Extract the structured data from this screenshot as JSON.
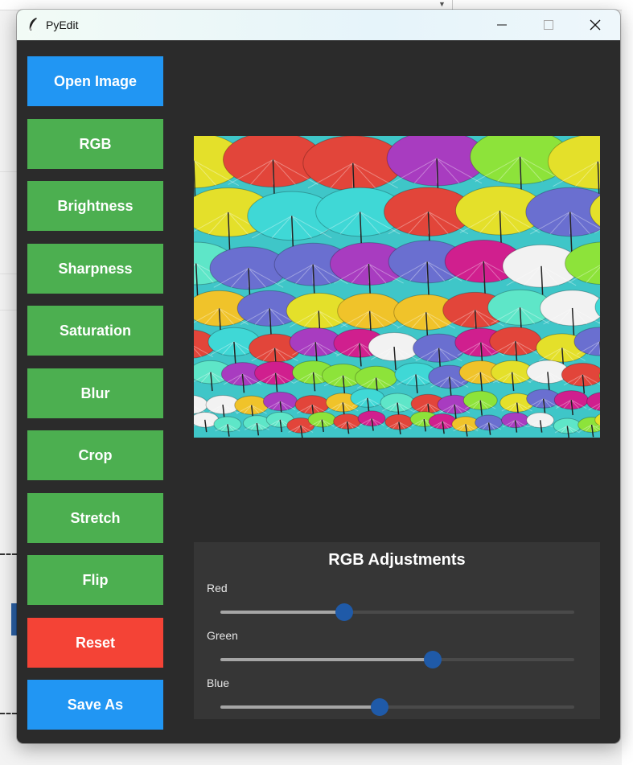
{
  "window": {
    "title": "PyEdit"
  },
  "sidebar": {
    "buttons": [
      {
        "label": "Open Image",
        "color": "#2196f3"
      },
      {
        "label": "RGB",
        "color": "#4caf50"
      },
      {
        "label": "Brightness",
        "color": "#4caf50"
      },
      {
        "label": "Sharpness",
        "color": "#4caf50"
      },
      {
        "label": "Saturation",
        "color": "#4caf50"
      },
      {
        "label": "Blur",
        "color": "#4caf50"
      },
      {
        "label": "Crop",
        "color": "#4caf50"
      },
      {
        "label": "Stretch",
        "color": "#4caf50"
      },
      {
        "label": "Flip",
        "color": "#4caf50"
      },
      {
        "label": "Reset",
        "color": "#f44336"
      },
      {
        "label": "Save As",
        "color": "#2196f3"
      }
    ]
  },
  "rgb_panel": {
    "title": "RGB Adjustments",
    "sliders": [
      {
        "label": "Red",
        "value_fraction": 0.35
      },
      {
        "label": "Green",
        "value_fraction": 0.6
      },
      {
        "label": "Blue",
        "value_fraction": 0.45
      }
    ]
  },
  "theme": {
    "background": "#2b2b2b",
    "panel": "#363636",
    "slider_thumb": "#1f5aa8"
  }
}
